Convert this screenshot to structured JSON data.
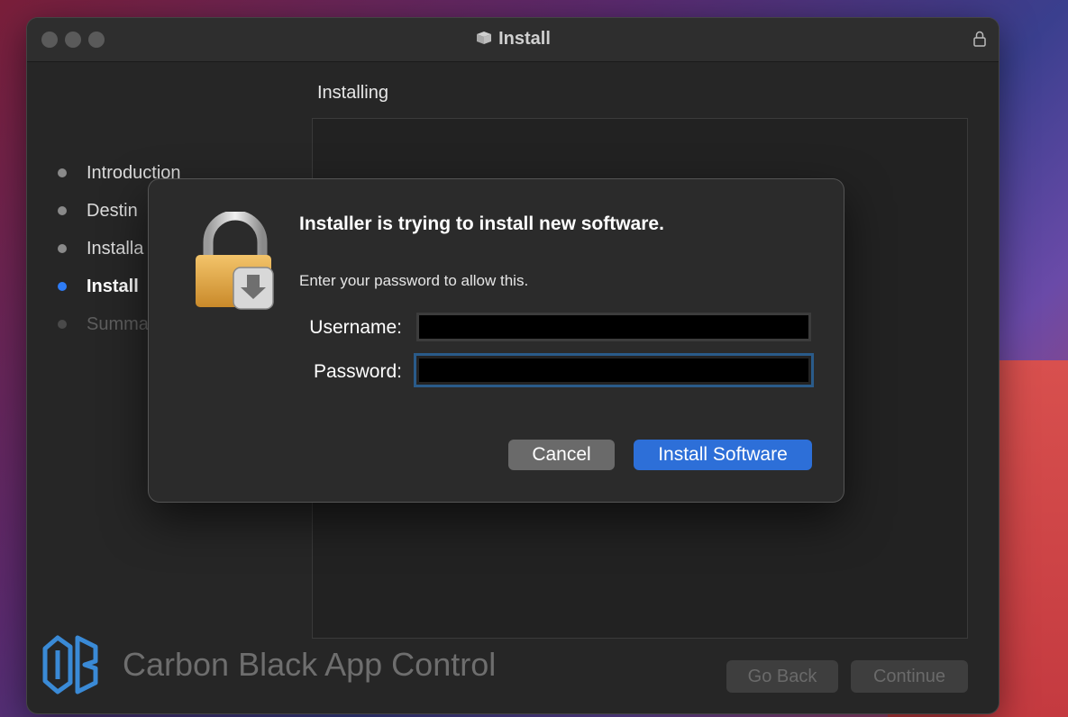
{
  "window": {
    "title": "Install",
    "heading": "Installing",
    "steps": [
      {
        "label": "Introduction",
        "state": "done"
      },
      {
        "label": "Destin",
        "state": "done"
      },
      {
        "label": "Installa",
        "state": "done"
      },
      {
        "label": "Install",
        "state": "active"
      },
      {
        "label": "Summa",
        "state": "future"
      }
    ],
    "brand": "Carbon Black App Control",
    "go_back_label": "Go Back",
    "continue_label": "Continue"
  },
  "dialog": {
    "title": "Installer is trying to install new software.",
    "subtitle": "Enter your password to allow this.",
    "username_label": "Username:",
    "password_label": "Password:",
    "username_value": "",
    "password_value": "",
    "cancel_label": "Cancel",
    "install_label": "Install Software"
  },
  "colors": {
    "accent": "#2d6fd8",
    "active_step_dot": "#2e7cf6",
    "brand_icon": "#3a8ad6"
  },
  "icons": [
    "box-icon",
    "lock-icon",
    "padlock-icon",
    "carbon-black-logo-icon"
  ]
}
